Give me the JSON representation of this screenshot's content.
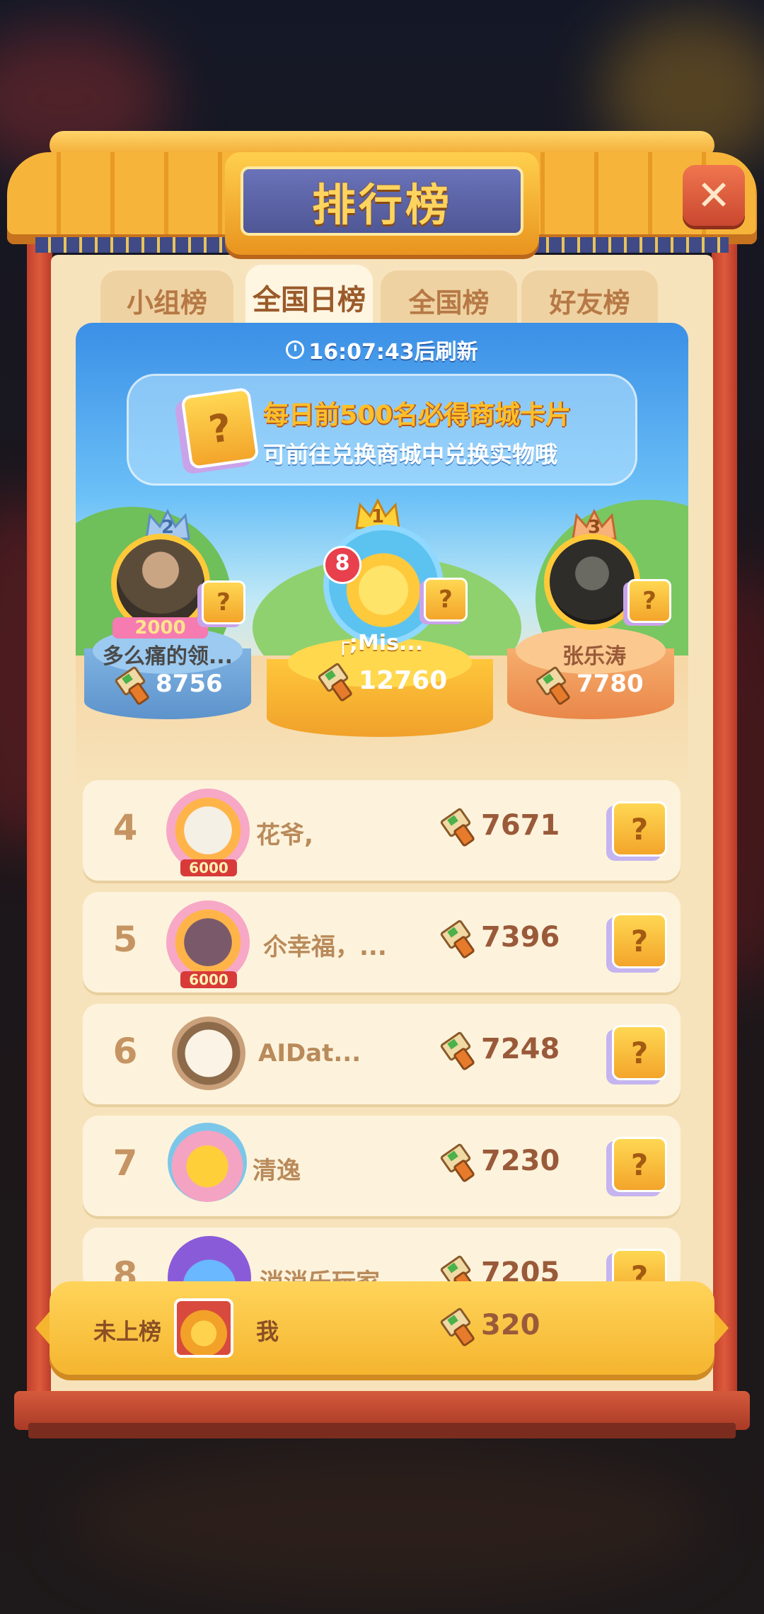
{
  "header": {
    "title": "排行榜"
  },
  "tabs": [
    {
      "label": "小组榜",
      "active": false
    },
    {
      "label": "全国日榜",
      "active": true
    },
    {
      "label": "全国榜",
      "active": false
    },
    {
      "label": "好友榜",
      "active": false
    }
  ],
  "timer": "16:07:43后刷新",
  "banner": {
    "line1": "每日前500名必得商城卡片",
    "line2": "可前往兑换商城中兑换实物哦",
    "card_mark": "?"
  },
  "podium": [
    {
      "rank": "1",
      "name": "┌;Mis...",
      "score": "12760",
      "level_badge": "8"
    },
    {
      "rank": "2",
      "name": "多么痛的领...",
      "score": "8756",
      "frame_badge": "2000"
    },
    {
      "rank": "3",
      "name": "张乐涛",
      "score": "7780"
    }
  ],
  "list": [
    {
      "rank": "4",
      "name": "花爷,",
      "score": "7671",
      "frame_badge": "6000"
    },
    {
      "rank": "5",
      "name": "尒幸福，...",
      "score": "7396",
      "frame_badge": "6000"
    },
    {
      "rank": "6",
      "name": "AIDat...",
      "score": "7248"
    },
    {
      "rank": "7",
      "name": "清逸",
      "score": "7230"
    },
    {
      "rank": "8",
      "name": "消消乐玩家",
      "score": "7205"
    }
  ],
  "my_row": {
    "status": "未上榜",
    "name": "我",
    "score": "320"
  },
  "colors": {
    "accent": "#f5b52f",
    "panel": "#f7e3bb",
    "title_plate": "#4f5796",
    "close": "#c9472f"
  },
  "icons": {
    "score": "paint-brush-icon",
    "reward": "question-card-icon",
    "close": "close-icon",
    "timer": "clock-icon"
  }
}
